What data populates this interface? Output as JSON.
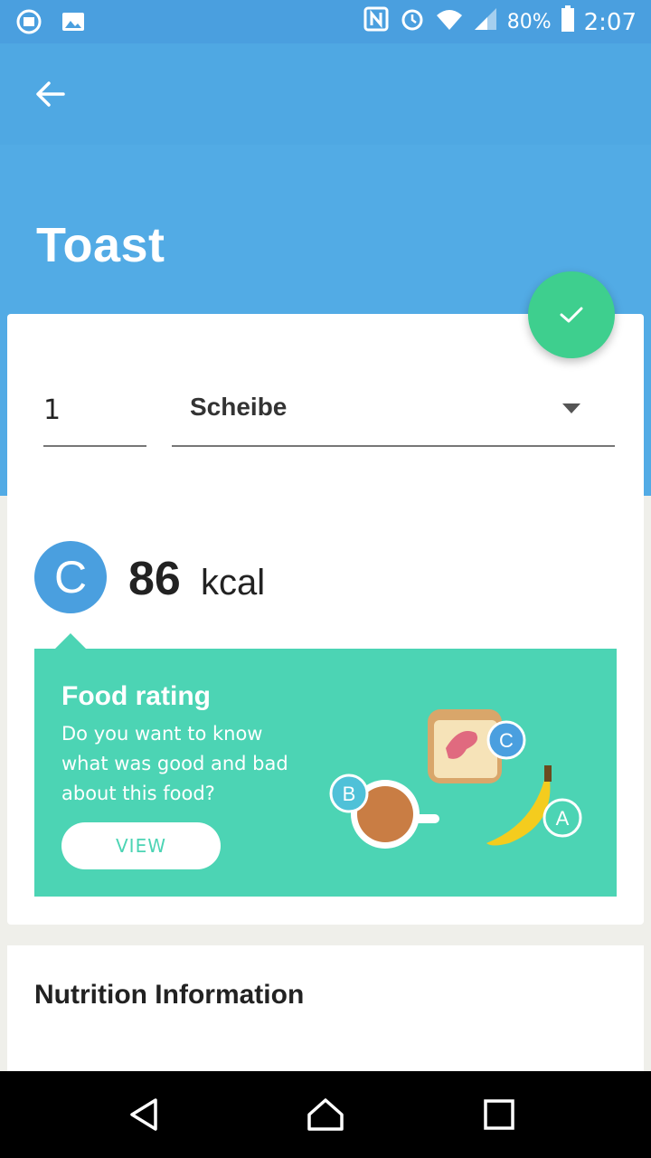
{
  "status_bar": {
    "battery_percent": "80%",
    "time": "2:07"
  },
  "header": {
    "title": "Toast"
  },
  "portion": {
    "quantity": "1",
    "unit": "Scheibe"
  },
  "summary": {
    "grade": "C",
    "kcal_value": "86",
    "kcal_unit": "kcal"
  },
  "food_rating": {
    "title": "Food rating",
    "text": "Do you want to know what was good and bad about this food?",
    "button_label": "VIEW",
    "badges": [
      "B",
      "C",
      "A"
    ]
  },
  "nutrition": {
    "title": "Nutrition Information"
  },
  "colors": {
    "primary": "#4fa8e3",
    "accent_green": "#3ecf8e",
    "teal": "#4cd4b4",
    "grade_blue": "#4a9fdf"
  }
}
